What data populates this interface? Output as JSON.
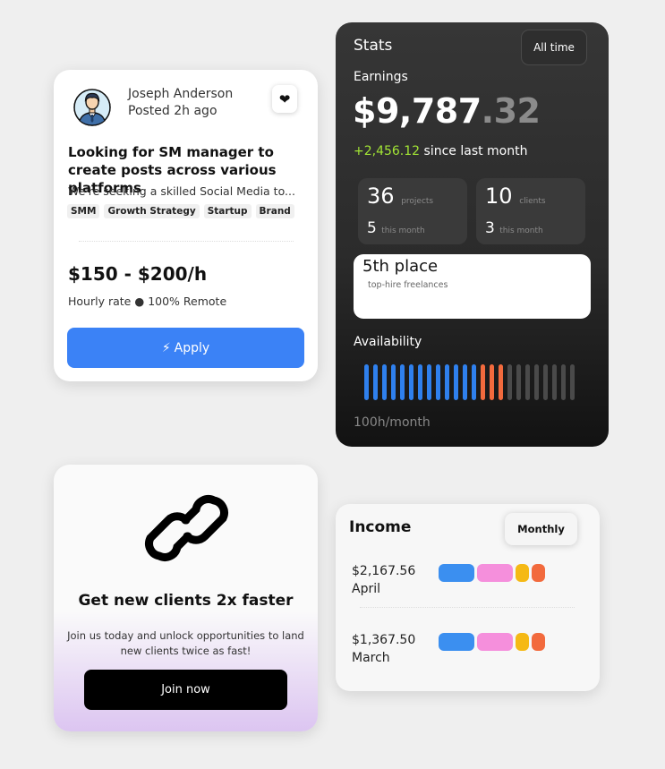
{
  "job": {
    "author_name": "Joseph Anderson",
    "posted": "Posted 2h ago",
    "heart": "❤",
    "title": "Looking for SM manager to create posts across various platforms",
    "description": "We're seeking a skilled Social Media to...",
    "tags": [
      "SMM",
      "Growth Strategy",
      "Startup",
      "Brand"
    ],
    "price": "$150 - $200/h",
    "meta": "Hourly rate ● 100% Remote",
    "apply_icon": "⚡",
    "apply_label": "Apply"
  },
  "stats": {
    "title": "Stats",
    "range_button": "All time",
    "earnings_label": "Earnings",
    "amount_main": "$9,787",
    "amount_cents": ".32",
    "change_value": "+2,456.12",
    "change_suffix": " since last month",
    "projects_count": "36",
    "projects_label": "projects",
    "projects_month": "5",
    "projects_month_label": "this month",
    "clients_count": "10",
    "clients_label": "clients",
    "clients_month": "3",
    "clients_month_label": "this month",
    "place_title": "5th place",
    "place_sub": "top-hire freelances",
    "availability_label": "Availability",
    "availability_footer": "100h/month",
    "availability_bars": {
      "total": 24,
      "segments": [
        {
          "count": 13,
          "color": "#2f80ed"
        },
        {
          "count": 3,
          "color": "#f26a3d"
        },
        {
          "count": 8,
          "color": "#4a4a4a"
        }
      ]
    }
  },
  "promo": {
    "icon": "link-icon",
    "title": "Get new clients 2x faster",
    "text": "Join us today and unlock opportunities to land new clients twice as fast!",
    "button": "Join now"
  },
  "income": {
    "title": "Income",
    "period_button": "Monthly",
    "rows": [
      {
        "amount": "$2,167.56",
        "month": "April"
      },
      {
        "amount": "$1,367.50",
        "month": "March"
      }
    ],
    "pill_colors": [
      "#3b8ff0",
      "#f58fdc",
      "#f5b915",
      "#f26a3d"
    ]
  }
}
